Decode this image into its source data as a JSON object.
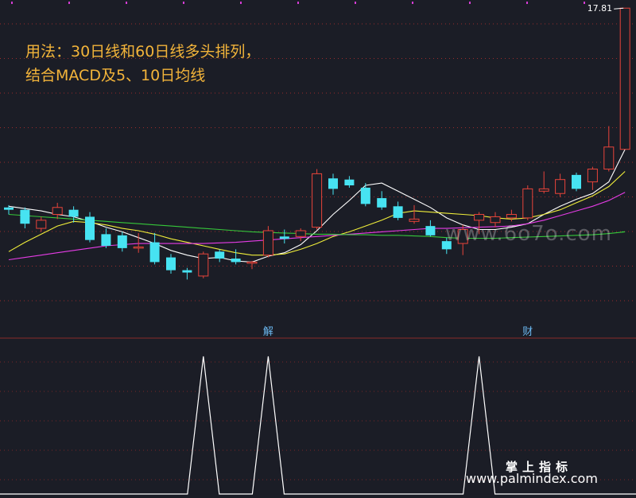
{
  "caption": {
    "line1": "用法：30日线和60日线多头排列，",
    "line2": "结合MACD及5、10日均线"
  },
  "watermarks": {
    "faint": "www.6o7o.com",
    "site_cn": "掌上指标",
    "site_url": "www.palmindex.com"
  },
  "colors": {
    "background": "#1b1d26",
    "up": "#e8443a",
    "down": "#47e3f2",
    "ma5": "#ffffff",
    "ma10": "#f0ee3a",
    "ma30": "#e63ce6",
    "ma60": "#36c83a",
    "caption": "#f3b43a",
    "marker": "#6bb8f0"
  },
  "chart_data": [
    {
      "type": "candlestick",
      "price_max_label": "17.81",
      "ylim": [
        12.2,
        17.95
      ],
      "grid": true,
      "candles": [
        {
          "o": 14.38,
          "h": 14.42,
          "l": 14.26,
          "c": 14.34
        },
        {
          "o": 14.34,
          "h": 14.38,
          "l": 14.02,
          "c": 14.1
        },
        {
          "o": 14.02,
          "h": 14.22,
          "l": 13.96,
          "c": 14.16
        },
        {
          "o": 14.26,
          "h": 14.46,
          "l": 14.18,
          "c": 14.38
        },
        {
          "o": 14.34,
          "h": 14.4,
          "l": 14.12,
          "c": 14.22
        },
        {
          "o": 14.22,
          "h": 14.3,
          "l": 13.78,
          "c": 13.82
        },
        {
          "o": 13.92,
          "h": 14.02,
          "l": 13.68,
          "c": 13.72
        },
        {
          "o": 13.9,
          "h": 13.96,
          "l": 13.62,
          "c": 13.68
        },
        {
          "o": 13.68,
          "h": 13.94,
          "l": 13.6,
          "c": 13.7
        },
        {
          "o": 13.78,
          "h": 13.94,
          "l": 13.4,
          "c": 13.44
        },
        {
          "o": 13.52,
          "h": 13.58,
          "l": 13.24,
          "c": 13.3
        },
        {
          "o": 13.3,
          "h": 13.34,
          "l": 13.14,
          "c": 13.26
        },
        {
          "o": 13.2,
          "h": 13.62,
          "l": 13.16,
          "c": 13.58
        },
        {
          "o": 13.62,
          "h": 13.66,
          "l": 13.44,
          "c": 13.5
        },
        {
          "o": 13.5,
          "h": 13.66,
          "l": 13.4,
          "c": 13.44
        },
        {
          "o": 13.42,
          "h": 13.46,
          "l": 13.32,
          "c": 13.44
        },
        {
          "o": 13.56,
          "h": 14.06,
          "l": 13.52,
          "c": 13.98
        },
        {
          "o": 13.88,
          "h": 14.0,
          "l": 13.76,
          "c": 13.84
        },
        {
          "o": 13.88,
          "h": 14.02,
          "l": 13.8,
          "c": 13.98
        },
        {
          "o": 14.04,
          "h": 15.04,
          "l": 14.0,
          "c": 14.96
        },
        {
          "o": 14.88,
          "h": 14.96,
          "l": 14.6,
          "c": 14.7
        },
        {
          "o": 14.86,
          "h": 14.92,
          "l": 14.72,
          "c": 14.76
        },
        {
          "o": 14.72,
          "h": 14.8,
          "l": 14.4,
          "c": 14.44
        },
        {
          "o": 14.54,
          "h": 14.66,
          "l": 14.34,
          "c": 14.38
        },
        {
          "o": 14.4,
          "h": 14.48,
          "l": 14.16,
          "c": 14.2
        },
        {
          "o": 14.14,
          "h": 14.42,
          "l": 14.1,
          "c": 14.18
        },
        {
          "o": 14.06,
          "h": 14.16,
          "l": 13.88,
          "c": 13.9
        },
        {
          "o": 13.8,
          "h": 13.86,
          "l": 13.58,
          "c": 13.66
        },
        {
          "o": 13.76,
          "h": 14.08,
          "l": 13.56,
          "c": 14.0
        },
        {
          "o": 14.16,
          "h": 14.3,
          "l": 13.92,
          "c": 14.26
        },
        {
          "o": 14.12,
          "h": 14.3,
          "l": 14.04,
          "c": 14.22
        },
        {
          "o": 14.2,
          "h": 14.34,
          "l": 14.14,
          "c": 14.26
        },
        {
          "o": 14.2,
          "h": 14.76,
          "l": 14.16,
          "c": 14.7
        },
        {
          "o": 14.66,
          "h": 15.0,
          "l": 14.62,
          "c": 14.7
        },
        {
          "o": 14.62,
          "h": 14.96,
          "l": 14.56,
          "c": 14.86
        },
        {
          "o": 14.94,
          "h": 14.98,
          "l": 14.66,
          "c": 14.7
        },
        {
          "o": 14.82,
          "h": 15.08,
          "l": 14.68,
          "c": 15.04
        },
        {
          "o": 15.04,
          "h": 15.78,
          "l": 15.0,
          "c": 15.42
        },
        {
          "o": 15.38,
          "h": 17.81,
          "l": 15.38,
          "c": 17.81
        }
      ],
      "moving_averages": [
        {
          "name": "MA5",
          "color": "#ffffff",
          "values": [
            14.4,
            14.36,
            14.32,
            14.26,
            14.22,
            14.14,
            14.04,
            13.96,
            13.86,
            13.76,
            13.64,
            13.56,
            13.5,
            13.52,
            13.46,
            13.44,
            13.54,
            13.6,
            13.74,
            13.98,
            14.26,
            14.5,
            14.76,
            14.8,
            14.66,
            14.52,
            14.38,
            14.2,
            14.08,
            14.0,
            14.0,
            14.04,
            14.1,
            14.26,
            14.4,
            14.52,
            14.62,
            14.82,
            15.38
          ]
        },
        {
          "name": "MA10",
          "color": "#f0ee3a",
          "values": [
            13.62,
            13.78,
            13.92,
            14.06,
            14.14,
            14.12,
            14.08,
            14.02,
            13.98,
            13.92,
            13.84,
            13.78,
            13.72,
            13.66,
            13.6,
            13.56,
            13.56,
            13.58,
            13.66,
            13.76,
            13.88,
            13.96,
            14.06,
            14.16,
            14.28,
            14.32,
            14.3,
            14.28,
            14.26,
            14.24,
            14.2,
            14.18,
            14.2,
            14.26,
            14.34,
            14.46,
            14.58,
            14.74,
            15.0
          ]
        },
        {
          "name": "MA30",
          "color": "#e63ce6",
          "values": [
            13.48,
            13.52,
            13.56,
            13.6,
            13.64,
            13.68,
            13.72,
            13.74,
            13.76,
            13.76,
            13.76,
            13.76,
            13.76,
            13.77,
            13.78,
            13.8,
            13.82,
            13.84,
            13.86,
            13.88,
            13.9,
            13.92,
            13.94,
            13.96,
            13.98,
            14.0,
            14.02,
            14.02,
            14.03,
            14.04,
            14.05,
            14.06,
            14.1,
            14.16,
            14.24,
            14.32,
            14.4,
            14.5,
            14.64
          ]
        },
        {
          "name": "MA60",
          "color": "#36c83a",
          "values": [
            14.26,
            14.24,
            14.22,
            14.2,
            14.18,
            14.16,
            14.14,
            14.12,
            14.1,
            14.08,
            14.06,
            14.04,
            14.02,
            14.0,
            13.98,
            13.96,
            13.95,
            13.94,
            13.93,
            13.92,
            13.92,
            13.91,
            13.91,
            13.9,
            13.9,
            13.89,
            13.88,
            13.86,
            13.85,
            13.85,
            13.85,
            13.86,
            13.87,
            13.88,
            13.89,
            13.9,
            13.91,
            13.93,
            13.96
          ]
        }
      ],
      "markers": [
        {
          "label": "解",
          "index": 16
        },
        {
          "label": "财",
          "index": 32
        }
      ]
    },
    {
      "type": "line",
      "panel": "indicator",
      "ylim": [
        0,
        1
      ],
      "grid": true,
      "values": [
        0,
        0,
        0,
        0,
        0,
        0,
        0,
        0,
        0,
        0,
        0,
        0,
        1,
        0,
        0,
        0,
        1,
        0,
        0,
        0,
        0,
        0,
        0,
        0,
        0,
        0,
        0,
        0,
        0,
        1,
        0,
        0,
        0,
        0,
        0,
        0,
        0,
        0,
        0
      ]
    }
  ]
}
